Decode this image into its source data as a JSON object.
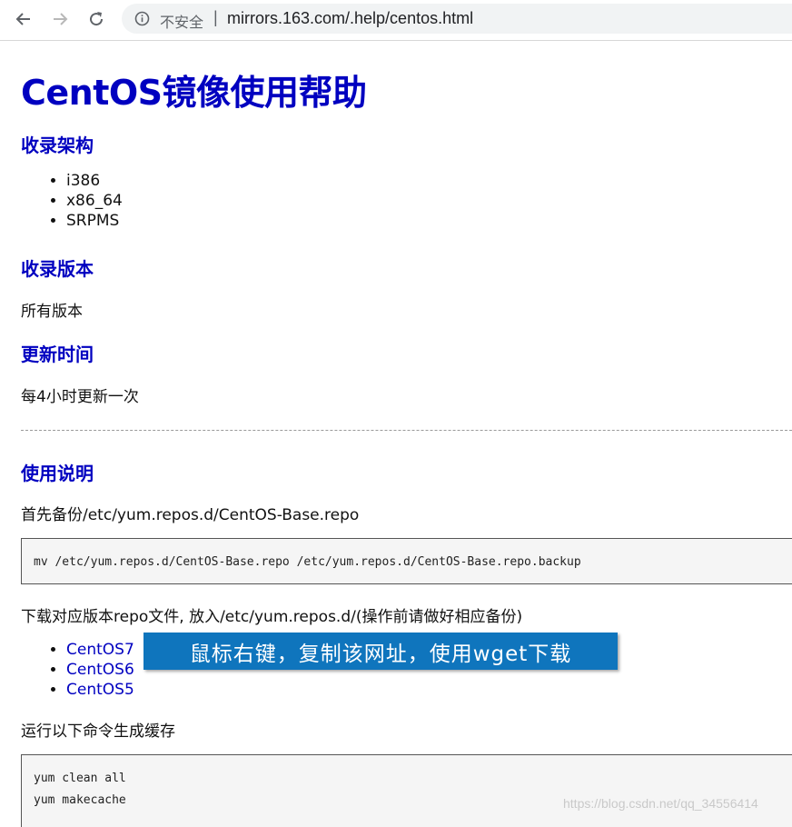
{
  "browser": {
    "security_label": "不安全",
    "separator": "|",
    "url": "mirrors.163.com/.help/centos.html"
  },
  "page": {
    "title": "CentOS镜像使用帮助",
    "sections": {
      "arch_heading": "收录架构",
      "arch_items": [
        "i386",
        "x86_64",
        "SRPMS"
      ],
      "version_heading": "收录版本",
      "version_text": "所有版本",
      "update_heading": "更新时间",
      "update_text": "每4小时更新一次",
      "usage_heading": "使用说明",
      "backup_text": "首先备份/etc/yum.repos.d/CentOS-Base.repo",
      "backup_cmd": "mv /etc/yum.repos.d/CentOS-Base.repo /etc/yum.repos.d/CentOS-Base.repo.backup",
      "download_text": "下载对应版本repo文件, 放入/etc/yum.repos.d/(操作前请做好相应备份)",
      "repo_links": [
        "CentOS7",
        "CentOS6",
        "CentOS5"
      ],
      "cache_text": "运行以下命令生成缓存",
      "cache_cmds": [
        "yum clean all",
        "yum makecache"
      ]
    }
  },
  "callout": {
    "text": "鼠标右键，复制该网址，使用wget下载",
    "color": "#0f75bd"
  },
  "watermark": "https://blog.csdn.net/qq_34556414",
  "colors": {
    "heading": "#0000c0",
    "link": "#0000c0"
  }
}
